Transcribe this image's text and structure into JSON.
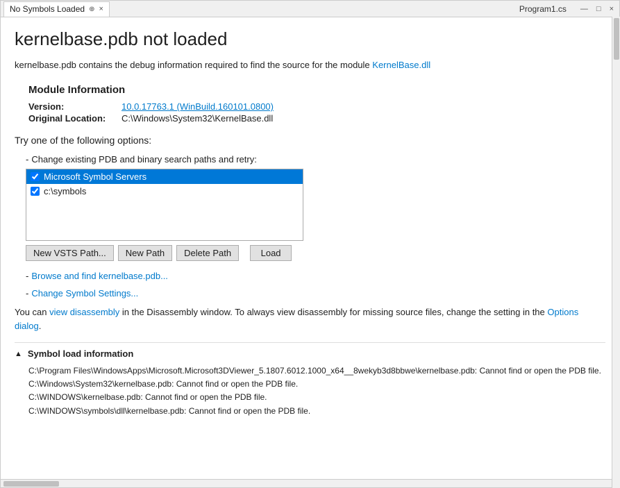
{
  "titlebar": {
    "tab_label": "No Symbols Loaded",
    "close_btn": "×",
    "pin_icon": "📌",
    "filename": "Program1.cs",
    "win_controls": [
      "—",
      "□",
      "×"
    ]
  },
  "main": {
    "title": "kernelbase.pdb not loaded",
    "description_prefix": "kernelbase.pdb contains the debug information required to find the source for the module ",
    "description_link": "KernelBase.dll",
    "module_section_title": "Module Information",
    "version_label": "Version:",
    "version_value": "10.0.17763.1 (WinBuild.160101.0800)",
    "location_label": "Original Location:",
    "location_value": "C:\\Windows\\System32\\KernelBase.dll",
    "options_title": "Try one of the following options:",
    "option1_dash": "-",
    "option1_text": "Change existing PDB and binary search paths and retry:",
    "paths": [
      {
        "label": "Microsoft Symbol Servers",
        "checked": true,
        "selected": true
      },
      {
        "label": "c:\\symbols",
        "checked": true,
        "selected": false
      }
    ],
    "btn_new_vsts": "New VSTS Path...",
    "btn_new_path": "New Path",
    "btn_delete_path": "Delete Path",
    "btn_load": "Load",
    "option2_dash": "-",
    "option2_link": "Browse and find kernelbase.pdb...",
    "option3_dash": "-",
    "option3_link": "Change Symbol Settings...",
    "inline_text_prefix": "You can ",
    "inline_link1": "view disassembly",
    "inline_text_mid": " in the Disassembly window. To always view disassembly for missing source files, change the setting in the ",
    "inline_link2": "Options dialog",
    "inline_text_end": ".",
    "symbol_section_label": "Symbol load information",
    "symbol_logs": [
      "C:\\Program Files\\WindowsApps\\Microsoft.Microsoft3DViewer_5.1807.6012.1000_x64__8wekyb3d8bbwe\\kernelbase.pdb: Cannot find or open the PDB file.",
      "C:\\Windows\\System32\\kernelbase.pdb: Cannot find or open the PDB file.",
      "C:\\WINDOWS\\kernelbase.pdb: Cannot find or open the PDB file.",
      "C:\\WINDOWS\\symbols\\dll\\kernelbase.pdb: Cannot find or open the PDB file."
    ]
  }
}
